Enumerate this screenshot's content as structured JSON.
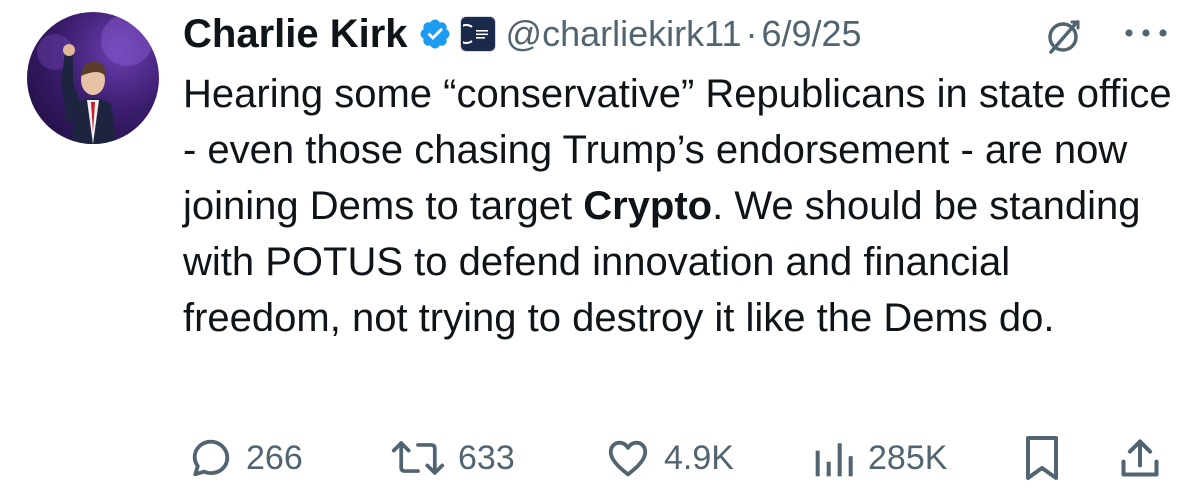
{
  "author": {
    "display_name": "Charlie Kirk",
    "handle": "@charliekirk11",
    "separator": "·",
    "date": "6/9/25",
    "verified_color": "#1d9bf0",
    "affiliation_badge": "turning-point-usa-badge"
  },
  "tweet": {
    "text_before": "Hearing some “conservative” Republicans in state office - even those chasing Trump’s endorsement - are now joining Dems to target ",
    "text_bold": "Crypto",
    "text_after": ". We should be standing with POTUS to defend innovation and financial freedom, not trying to destroy it like the Dems do."
  },
  "actions": {
    "replies": "266",
    "reposts": "633",
    "likes": "4.9K",
    "views": "285K"
  },
  "colors": {
    "text": "#0f1419",
    "secondary": "#536471",
    "accent": "#1d9bf0"
  }
}
